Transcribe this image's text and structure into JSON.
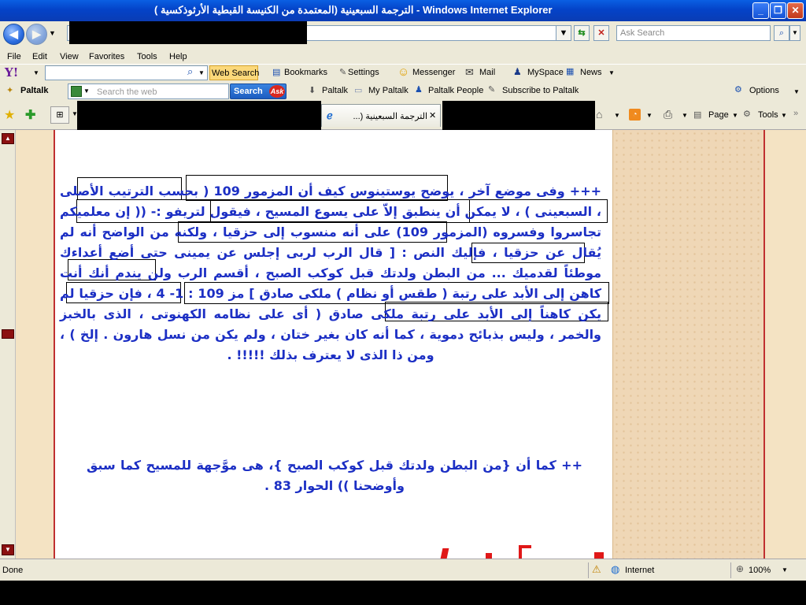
{
  "window": {
    "title": "الترجمة السبعينية (المعتمدة من الكنيسة القبطية الأرثوذكسية ) - Windows Internet Explorer"
  },
  "address_bar": {
    "search_placeholder": "Ask Search"
  },
  "menu": [
    "File",
    "Edit",
    "View",
    "Favorites",
    "Tools",
    "Help"
  ],
  "yahoo_toolbar": {
    "web_search": "Web Search",
    "bookmarks": "Bookmarks",
    "settings": "Settings",
    "messenger": "Messenger",
    "mail": "Mail",
    "myspace": "MySpace",
    "news": "News"
  },
  "paltalk_toolbar": {
    "brand": "Paltalk",
    "search_placeholder": "Search the web",
    "search_button": "Search",
    "paltalk": "Paltalk",
    "my_paltalk": "My Paltalk",
    "paltalk_people": "Paltalk People",
    "subscribe": "Subscribe to Paltalk",
    "options": "Options"
  },
  "tab_toolbar": {
    "tab_label": "الترجمة السبعينية (...",
    "page": "Page",
    "tools": "Tools"
  },
  "content": {
    "paragraph1": "+++ وفى موضع آخر ، يوضح يوستينوس كيف أن المزمور 109 ( بحسب الترتيب الأصلى ، السبعينى ) ، لا يمكن أن ينطبق إلاّ على يسوع المسيح ، فيقول لتريفو :- (( إن معلميكم تجاسروا وفسروه (المزمور 109) على أنه منسوب إلى حزقيا ، ولكنه من الواضح أنه لم يُقال عن حزقيا ، فإليك النص : [ قال الرب لربى إجلس عن يمينى حتى أضع أعداءك موطئاً لقدميك ... من البطن ولدتك قبل كوكب الصبح ، أقسم الرب ولن يندم أنك أنت كاهن إلى الأبد على رتبة ( طقس أو نظام ) ملكى صادق ] مز 109 : 1- 4 ، فإن حزقيا لم يكن كاهناً إلى الأبد على رتبة ملكى صادق ( أى على نظامه الكهنوتى ، الذى بالخبز والخمر ، وليس بذبائح دموية ، كما أنه كان بغير ختان ، ولم يكن من نسل هارون . إلخ ) ، ومن ذا الذى لا يعترف بذلك !!!!! .",
    "paragraph2": "++ كما أن {من البطن ولدتك قبل كوكب الصبح }، هى موَّجهة للمسيح كما سبق وأوضحنا )) الحوار 83 ."
  },
  "status": {
    "text": "Done",
    "zone": "Internet",
    "zoom": "100%"
  },
  "colors": {
    "title_blue": "#0a4fd8",
    "body_text": "#1c2fc4",
    "page_accent": "#c03030"
  }
}
